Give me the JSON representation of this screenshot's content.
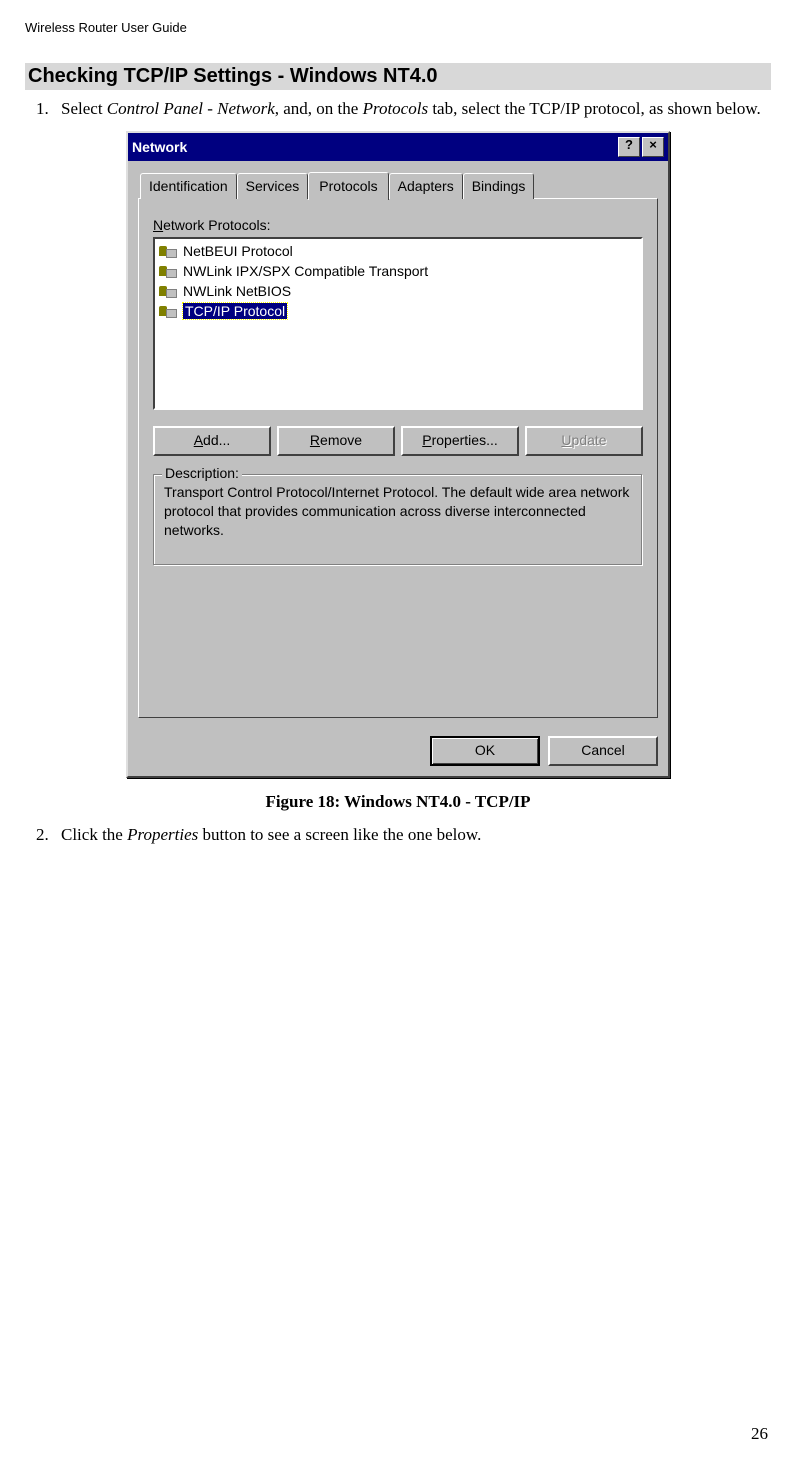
{
  "header": "Wireless Router User Guide",
  "section_heading": "Checking TCP/IP Settings - Windows NT4.0",
  "steps": {
    "s1_pre": "Select ",
    "s1_i1": "Control Panel - Network",
    "s1_mid": ", and, on the ",
    "s1_i2": "Protocols",
    "s1_post": " tab, select the TCP/IP protocol, as shown below.",
    "s2_pre": "Click the ",
    "s2_i1": "Properties",
    "s2_post": " button to see a screen like the one below."
  },
  "dialog": {
    "title": "Network",
    "help_btn": "?",
    "close_btn": "×",
    "tabs": {
      "identification": "Identification",
      "services": "Services",
      "protocols": "Protocols",
      "adapters": "Adapters",
      "bindings": "Bindings"
    },
    "panel_label_mn": "N",
    "panel_label_rest": "etwork Protocols:",
    "items": [
      "NetBEUI Protocol",
      "NWLink IPX/SPX Compatible Transport",
      "NWLink NetBIOS",
      "TCP/IP Protocol"
    ],
    "buttons": {
      "add_mn": "A",
      "add_rest": "dd...",
      "remove_mn": "R",
      "remove_rest": "emove",
      "properties_mn": "P",
      "properties_rest": "roperties...",
      "update_mn": "U",
      "update_rest": "pdate"
    },
    "group_label": "Description:",
    "group_text": "Transport Control Protocol/Internet Protocol. The default wide area network protocol that provides communication across diverse interconnected networks.",
    "ok": "OK",
    "cancel": "Cancel"
  },
  "figure_caption": "Figure 18: Windows NT4.0 - TCP/IP",
  "page_number": "26"
}
